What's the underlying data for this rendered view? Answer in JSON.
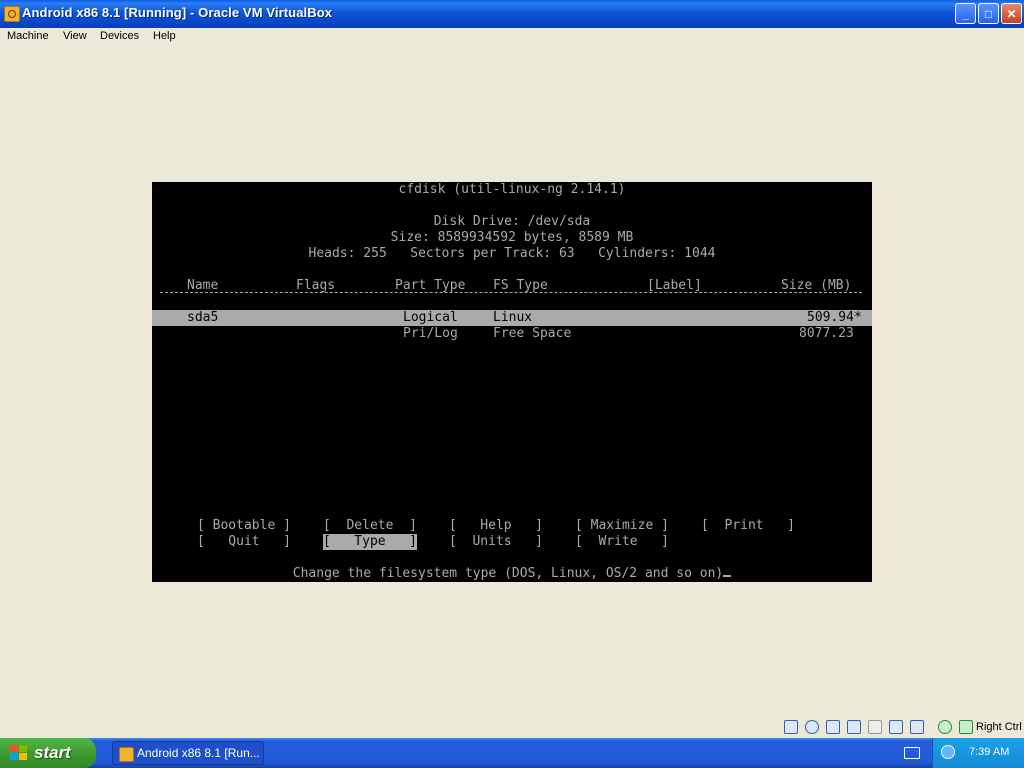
{
  "window": {
    "title": "Android x86 8.1 [Running] - Oracle VM VirtualBox",
    "controls": {
      "minimize": "_",
      "maximize": "□",
      "close": "✕"
    }
  },
  "menubar": [
    "Machine",
    "View",
    "Devices",
    "Help"
  ],
  "cfdisk": {
    "header": "cfdisk (util-linux-ng 2.14.1)",
    "disk_drive": "Disk Drive: /dev/sda",
    "size_line": "Size: 8589934592 bytes, 8589 MB",
    "geometry_line": "Heads: 255   Sectors per Track: 63   Cylinders: 1044",
    "columns": [
      "Name",
      "Flags",
      "Part Type",
      "FS Type",
      "[Label]",
      "Size (MB)"
    ],
    "rows": [
      {
        "name": "sda5",
        "flags": "",
        "part_type": "Logical",
        "fs_type": "Linux",
        "label": "",
        "size": "509.94*"
      },
      {
        "name": "",
        "flags": "",
        "part_type": "Pri/Log",
        "fs_type": "Free Space",
        "label": "",
        "size": "8077.23"
      }
    ],
    "menu_row1": [
      "[ Bootable ]",
      "[  Delete  ]",
      "[   Help   ]",
      "[ Maximize ]",
      "[  Print   ]"
    ],
    "menu_row2": [
      "[   Quit   ]",
      "[   Type   ]",
      "[  Units   ]",
      "[  Write   ]"
    ],
    "selected_menu": "[   Type   ]",
    "status_message": "Change the filesystem type (DOS, Linux, OS/2 and so on)"
  },
  "statusbar": {
    "host_key": "Right Ctrl"
  },
  "taskbar": {
    "start_label": "start",
    "task_label": "Android x86 8.1 [Run...",
    "clock": "7:39 AM"
  },
  "colors": {
    "titlebar": "#0b57d6",
    "desktop_bg": "#ece9d8",
    "vm_bg": "#000000",
    "terminal_text": "#aaaaaa",
    "taskbar": "#225ad8",
    "start": "#3e9c32"
  }
}
